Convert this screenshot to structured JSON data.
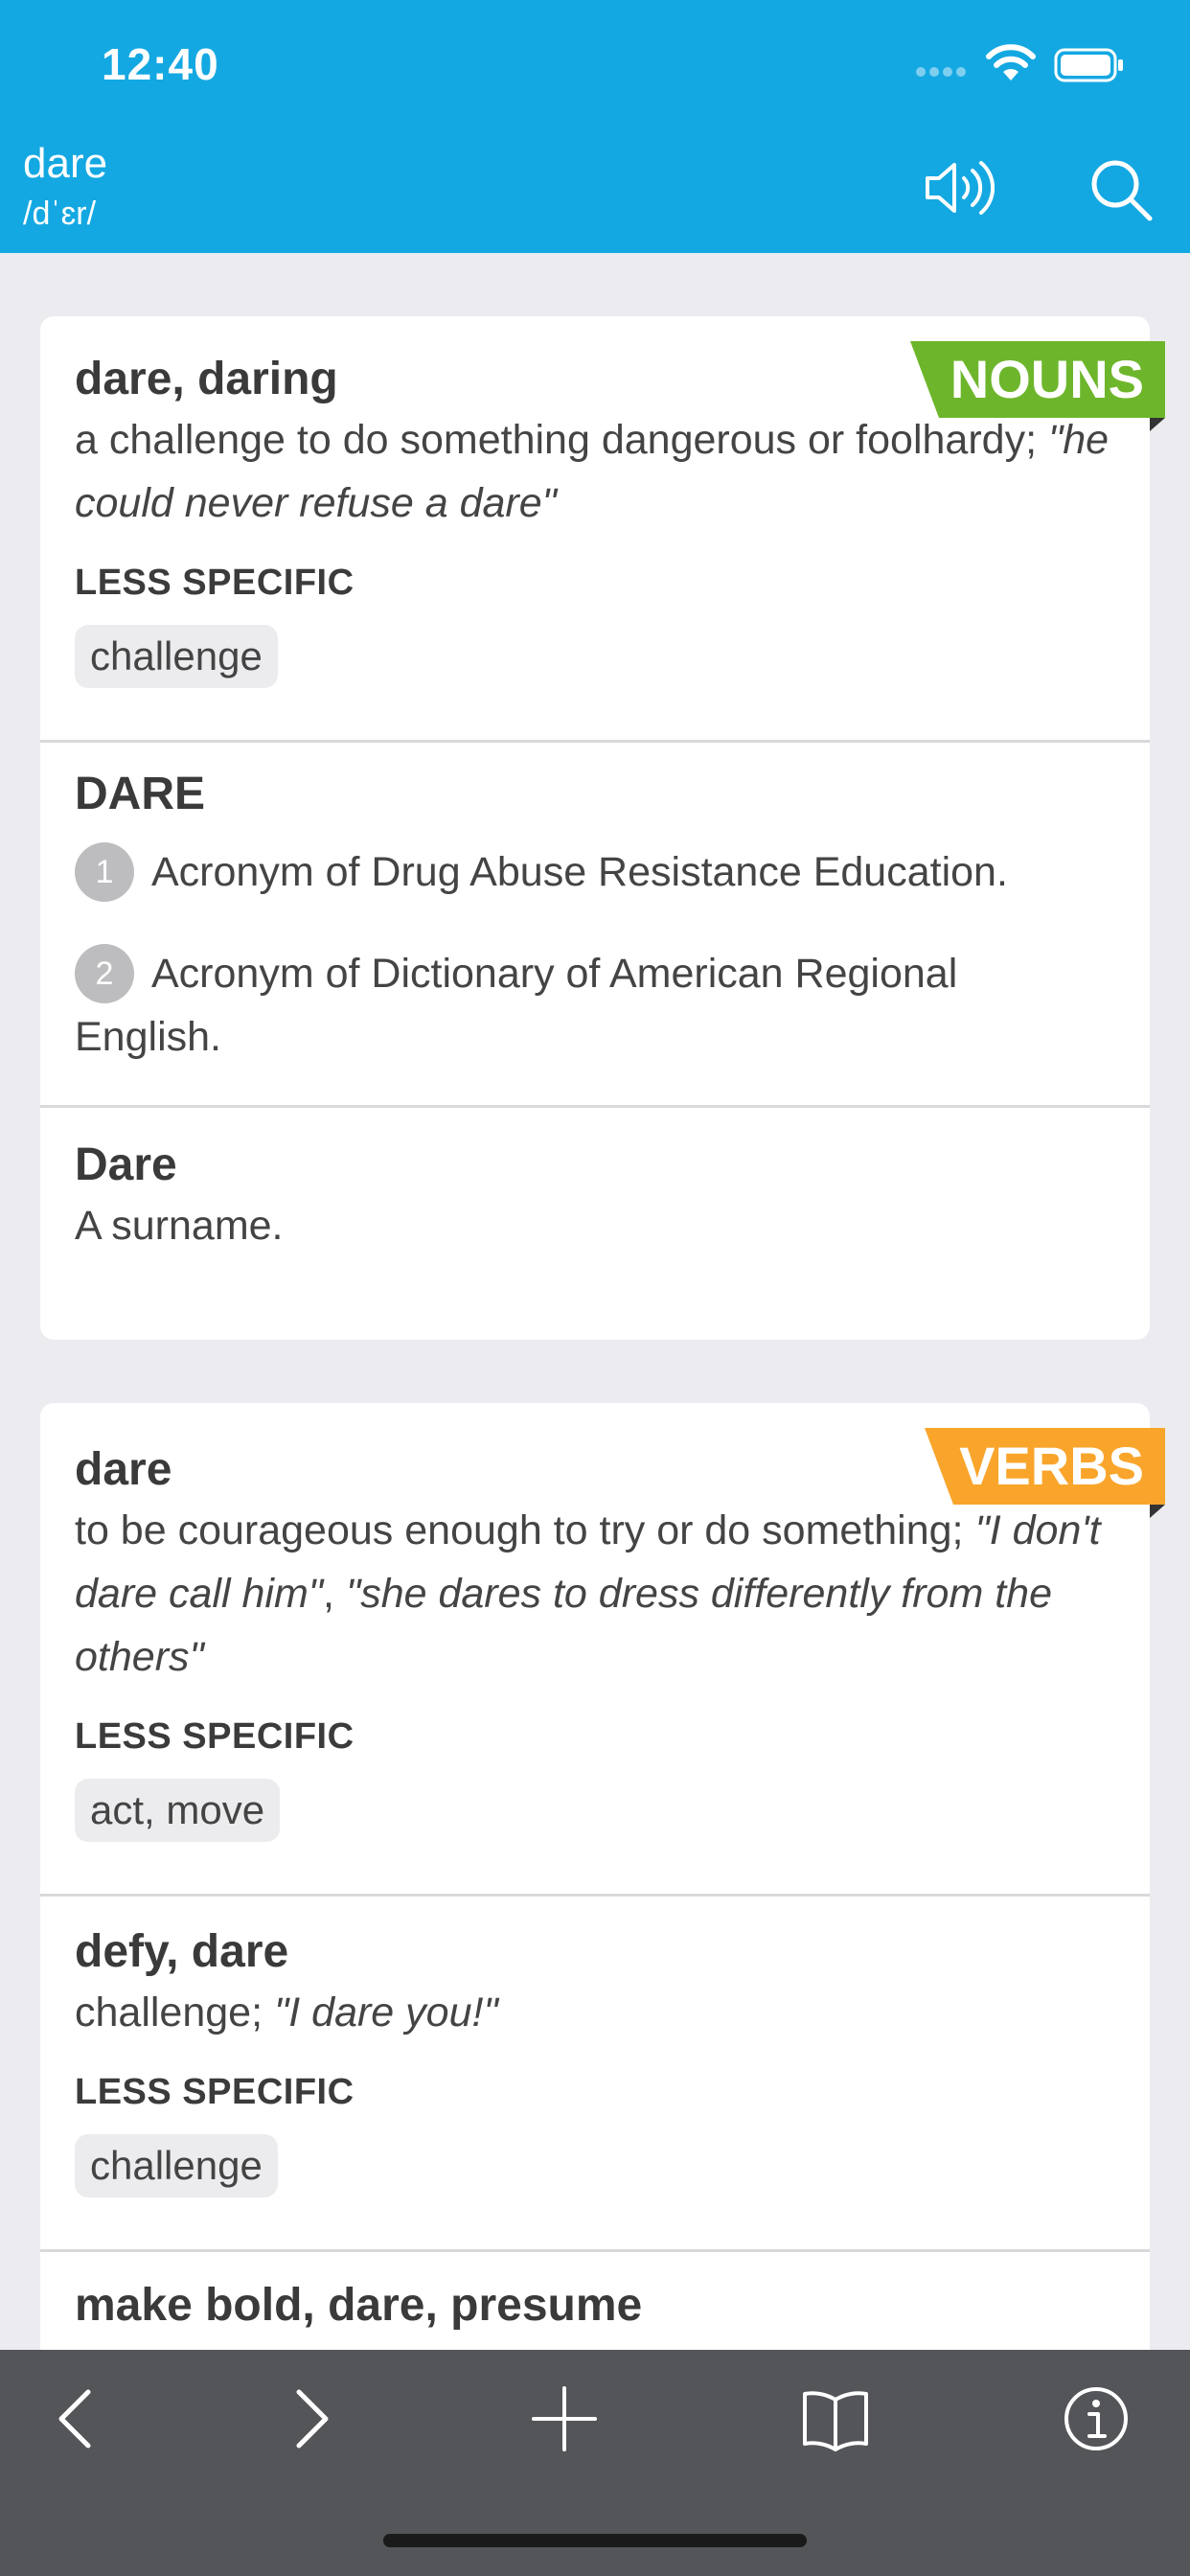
{
  "status": {
    "time": "12:40"
  },
  "header": {
    "word": "dare",
    "pronunciation": "/dˈɛr/"
  },
  "nouns": {
    "badge": "NOUNS",
    "entries": [
      {
        "word": "dare, daring",
        "def": "a challenge to do something dangerous or foolhardy; ",
        "example": "\"he could never refuse a dare\"",
        "label": "LESS SPECIFIC",
        "chip": "challenge"
      },
      {
        "word": "DARE",
        "senses": [
          {
            "num": "1",
            "text": "Acronym of Drug Abuse Resistance Education."
          },
          {
            "num": "2",
            "text": "Acronym of Dictionary of American Regional English."
          }
        ]
      },
      {
        "word": "Dare",
        "def": "A surname."
      }
    ]
  },
  "verbs": {
    "badge": "VERBS",
    "entries": [
      {
        "word": "dare",
        "def": "to be courageous enough to try or do something; ",
        "example1": "\"I don't dare call him\"",
        "sep": ", ",
        "example2": "\"she dares to dress differently from the others\"",
        "label": "LESS SPECIFIC",
        "chip": "act, move"
      },
      {
        "word": "defy, dare",
        "def": "challenge; ",
        "example": "\"I dare you!\"",
        "label": "LESS SPECIFIC",
        "chip": "challenge"
      },
      {
        "word": "make bold, dare, presume"
      }
    ]
  }
}
